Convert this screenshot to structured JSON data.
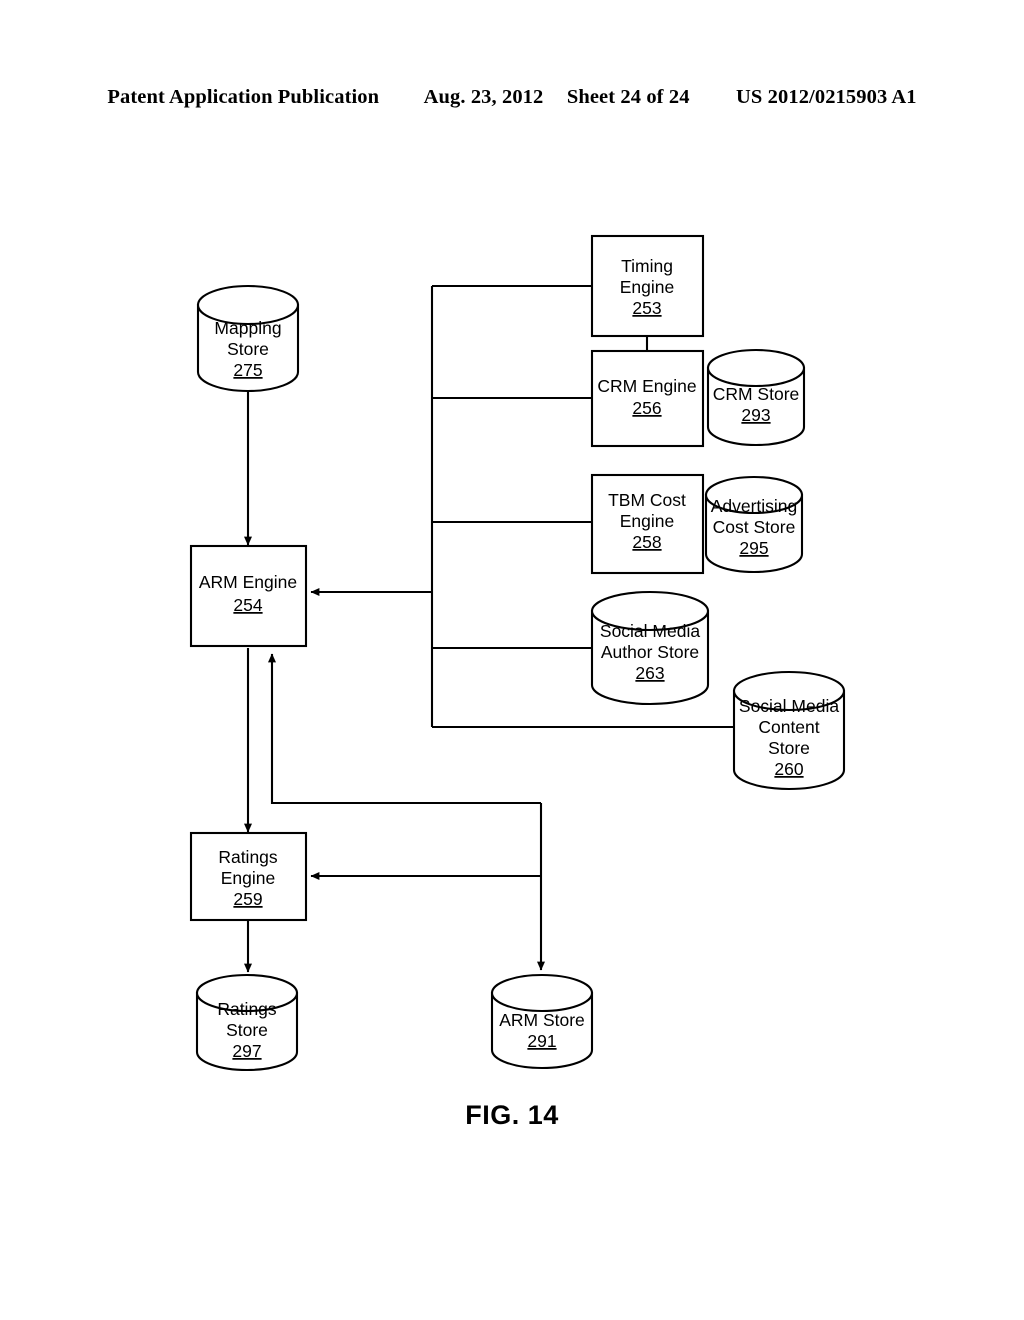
{
  "header": {
    "publication": "Patent Application Publication",
    "date": "Aug. 23, 2012",
    "sheet": "Sheet 24 of 24",
    "patent_number": "US 2012/0215903 A1"
  },
  "figure": {
    "caption": "FIG. 14",
    "nodes": {
      "mapping_store": {
        "shape": "cylinder",
        "line1": "Mapping",
        "line2": "Store",
        "ref": "275"
      },
      "arm_engine": {
        "shape": "box",
        "line1": "ARM Engine",
        "ref": "254"
      },
      "ratings_engine": {
        "shape": "box",
        "line1": "Ratings",
        "line2": "Engine",
        "ref": "259"
      },
      "ratings_store": {
        "shape": "cylinder",
        "line1": "Ratings",
        "line2": "Store",
        "ref": "297"
      },
      "arm_store": {
        "shape": "cylinder",
        "line1": "ARM Store",
        "ref": "291"
      },
      "timing_engine": {
        "shape": "box",
        "line1": "Timing",
        "line2": "Engine",
        "ref": "253"
      },
      "crm_engine": {
        "shape": "box",
        "line1": "CRM Engine",
        "ref": "256"
      },
      "crm_store": {
        "shape": "cylinder",
        "line1": "CRM Store",
        "ref": "293"
      },
      "tbm_cost_engine": {
        "shape": "box",
        "line1": "TBM Cost",
        "line2": "Engine",
        "ref": "258"
      },
      "advertising_cost_store": {
        "shape": "cylinder",
        "line1": "Advertising",
        "line2": "Cost Store",
        "ref": "295"
      },
      "social_media_author_store": {
        "shape": "cylinder",
        "line1": "Social Media",
        "line2": "Author Store",
        "ref": "263"
      },
      "social_media_content_store": {
        "shape": "cylinder",
        "line1": "Social Media",
        "line2": "Content",
        "line3": "Store",
        "ref": "260"
      }
    }
  },
  "colors": {
    "ink": "#000000",
    "paper": "#ffffff"
  }
}
